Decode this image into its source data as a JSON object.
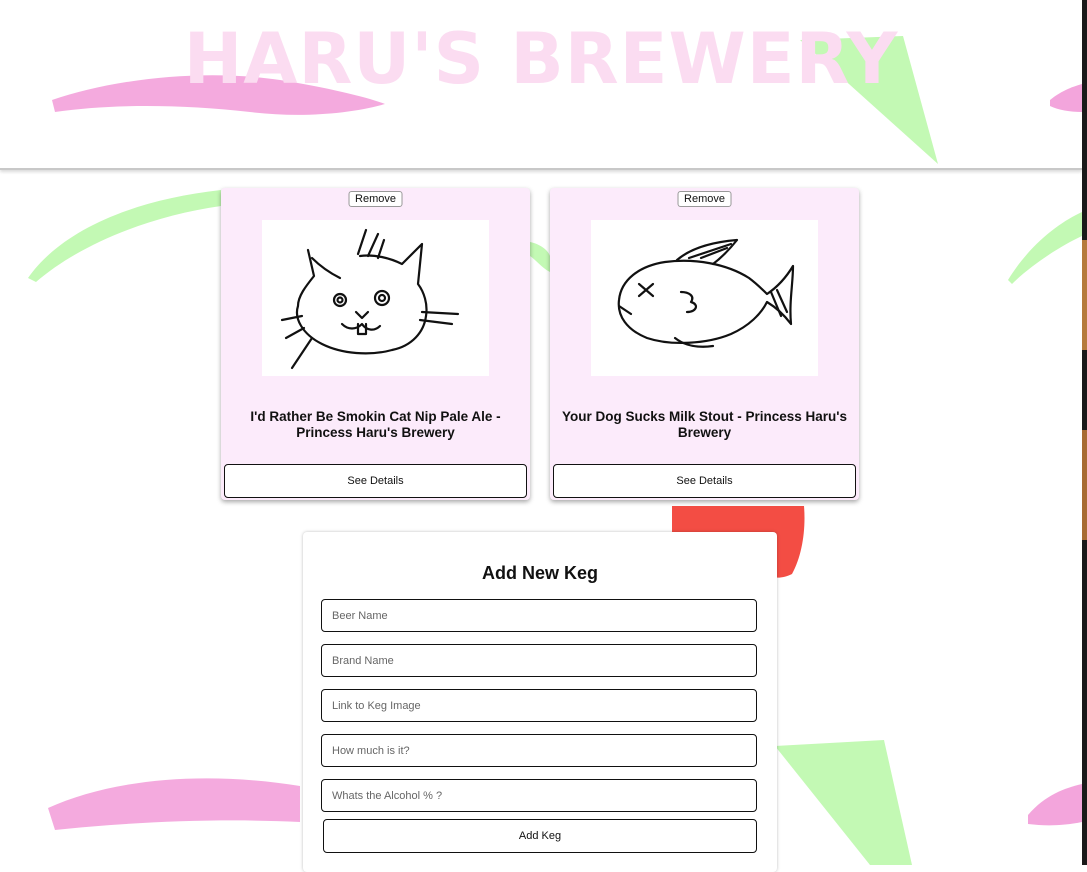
{
  "header": {
    "title": "HARU'S BREWERY"
  },
  "kegs": [
    {
      "remove_label": "Remove",
      "image_icon": "cat-doodle-icon",
      "title": "I'd Rather Be Smokin Cat Nip Pale Ale - Princess Haru's Brewery",
      "details_label": "See Details"
    },
    {
      "remove_label": "Remove",
      "image_icon": "fish-doodle-icon",
      "title": "Your Dog Sucks Milk Stout - Princess Haru's Brewery",
      "details_label": "See Details"
    }
  ],
  "form": {
    "title": "Add New Keg",
    "fields": {
      "beer_name": {
        "placeholder": "Beer Name",
        "value": ""
      },
      "brand_name": {
        "placeholder": "Brand Name",
        "value": ""
      },
      "image_link": {
        "placeholder": "Link to Keg Image",
        "value": ""
      },
      "price": {
        "placeholder": "How much is it?",
        "value": ""
      },
      "alcohol": {
        "placeholder": "Whats the Alcohol % ?",
        "value": ""
      }
    },
    "submit_label": "Add Keg"
  },
  "colors": {
    "brand_pink": "#fbdcf1",
    "card_bg": "#fcebfb",
    "brush_pink": "#f2a3d9",
    "brush_green": "#bff8b0",
    "brush_red": "#f2433a"
  }
}
